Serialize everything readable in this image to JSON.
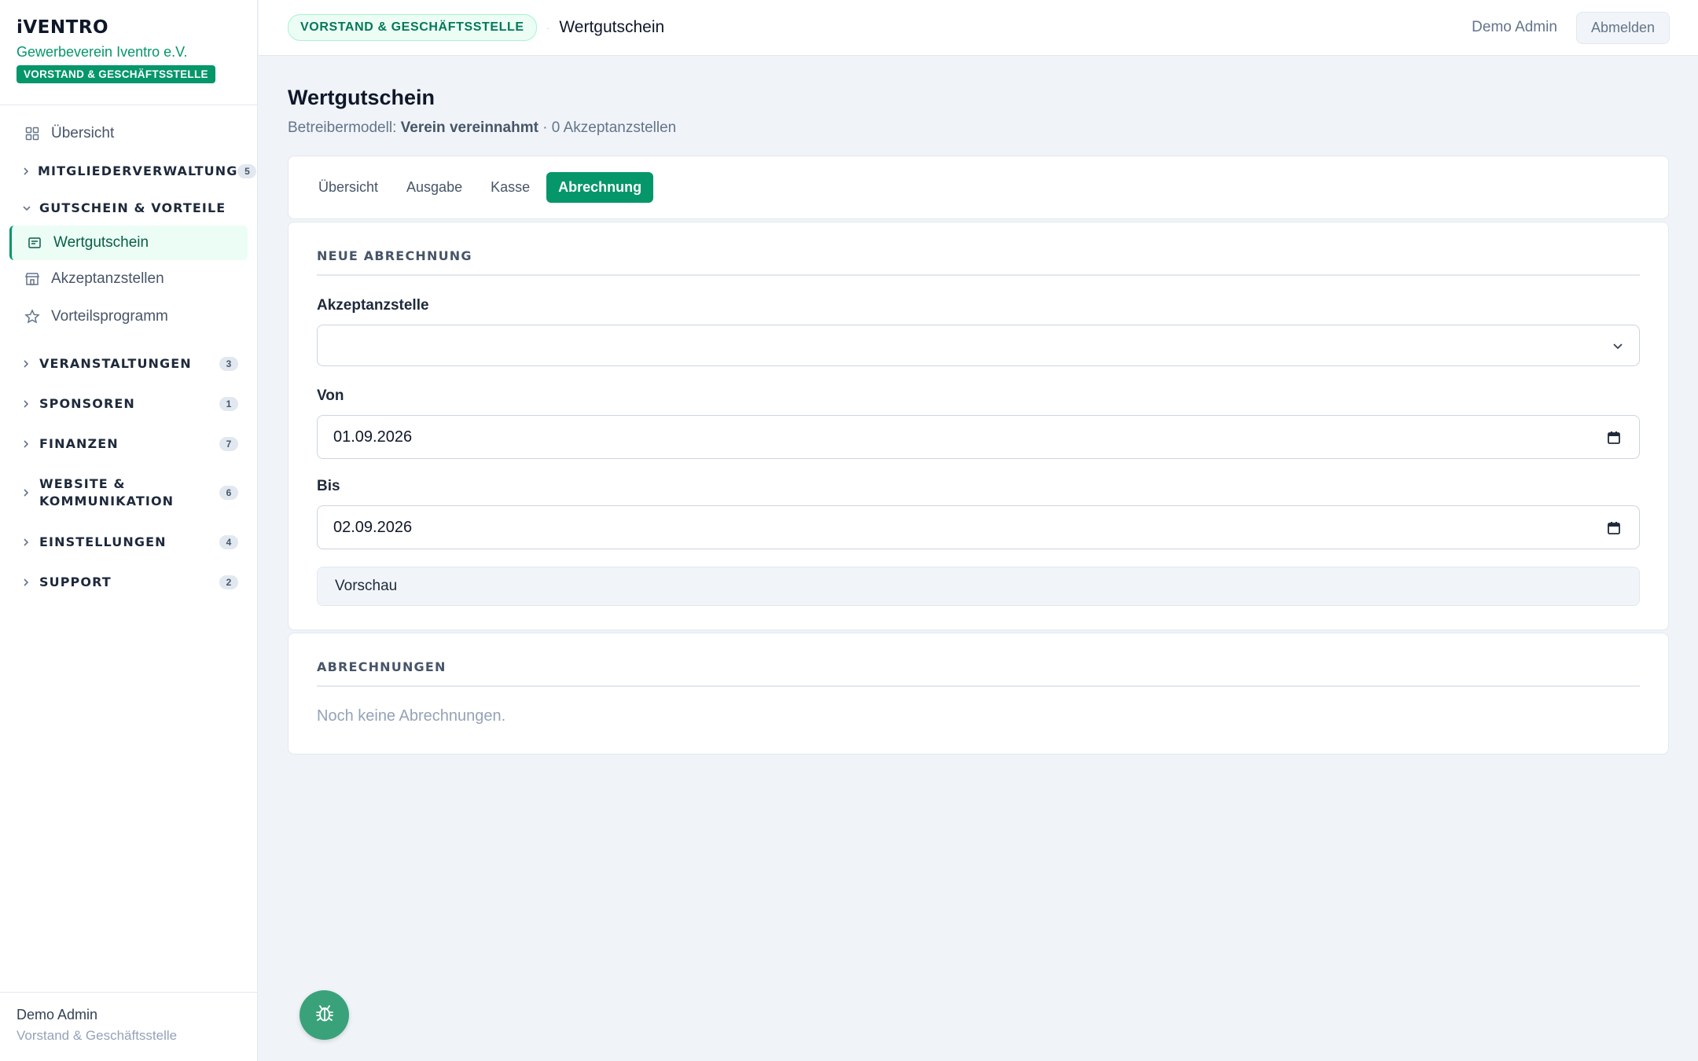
{
  "brand": {
    "logo": "iVENTRO",
    "org": "Gewerbeverein Iventro e.V.",
    "role_badge": "VORSTAND & GESCHÄFTSSTELLE"
  },
  "sidebar": {
    "overview": "Übersicht",
    "groups": [
      {
        "label": "MITGLIEDERVERWALTUNG",
        "count": "5"
      },
      {
        "label": "GUTSCHEIN & VORTEILE",
        "expanded": true
      },
      {
        "label": "VERANSTALTUNGEN",
        "count": "3"
      },
      {
        "label": "SPONSOREN",
        "count": "1"
      },
      {
        "label": "FINANZEN",
        "count": "7"
      },
      {
        "label": "WEBSITE &",
        "label2": "KOMMUNIKATION",
        "count": "6"
      },
      {
        "label": "EINSTELLUNGEN",
        "count": "4"
      },
      {
        "label": "SUPPORT",
        "count": "2"
      }
    ],
    "sub_items": [
      "Wertgutschein",
      "Akzeptanzstellen",
      "Vorteilsprogramm"
    ],
    "footer": {
      "name": "Demo Admin",
      "role": "Vorstand & Geschäftsstelle"
    }
  },
  "topbar": {
    "pill": "VORSTAND & GESCHÄFTSSTELLE",
    "separator": "·",
    "crumb": "Wertgutschein",
    "user": "Demo Admin",
    "logout": "Abmelden"
  },
  "page": {
    "title": "Wertgutschein",
    "sub_prefix": "Betreibermodell:",
    "sub_model": "Verein vereinnahmt",
    "sub_suffix": "· 0 Akzeptanzstellen"
  },
  "tabs": [
    "Übersicht",
    "Ausgabe",
    "Kasse",
    "Abrechnung"
  ],
  "new_billing": {
    "title": "NEUE ABRECHNUNG",
    "acceptance_label": "Akzeptanzstelle",
    "acceptance_value": "",
    "from_label": "Von",
    "from_value": "01.09.2026",
    "to_label": "Bis",
    "to_value": "02.09.2026",
    "preview_button": "Vorschau"
  },
  "billings": {
    "title": "ABRECHNUNGEN",
    "empty": "Noch keine Abrechnungen."
  },
  "colors": {
    "accent": "#059669",
    "accent_light": "#ecfdf5",
    "fab": "#3aa27a"
  },
  "icons": {
    "fab": "bug-icon"
  }
}
